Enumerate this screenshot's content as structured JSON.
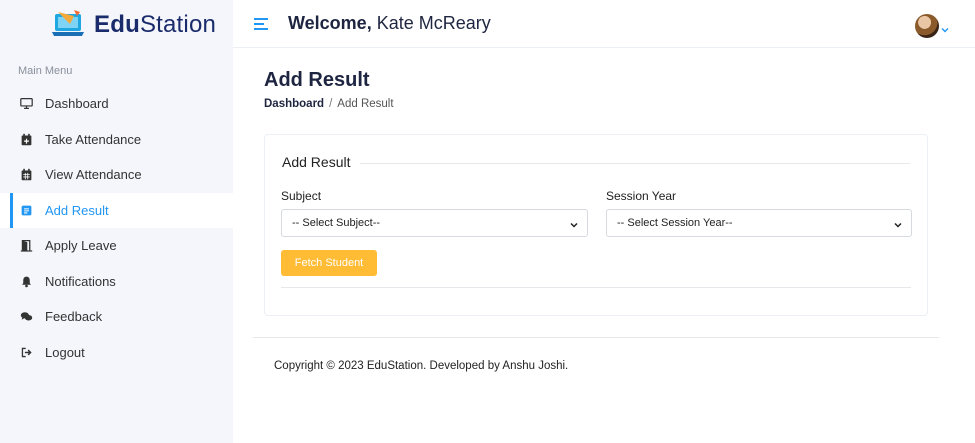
{
  "brand": {
    "name_bold": "Edu",
    "name_rest": "Station"
  },
  "header": {
    "welcome_prefix": "Welcome,",
    "user_name": "Kate McReary"
  },
  "sidebar": {
    "menu_title": "Main Menu",
    "items": [
      {
        "label": "Dashboard",
        "icon": "monitor-icon",
        "active": false
      },
      {
        "label": "Take Attendance",
        "icon": "calendar-plus-icon",
        "active": false
      },
      {
        "label": "View Attendance",
        "icon": "calendar-icon",
        "active": false
      },
      {
        "label": "Add Result",
        "icon": "document-icon",
        "active": true
      },
      {
        "label": "Apply Leave",
        "icon": "door-icon",
        "active": false
      },
      {
        "label": "Notifications",
        "icon": "bell-icon",
        "active": false
      },
      {
        "label": "Feedback",
        "icon": "comments-icon",
        "active": false
      },
      {
        "label": "Logout",
        "icon": "sign-out-icon",
        "active": false
      }
    ]
  },
  "page": {
    "title": "Add Result",
    "breadcrumb": {
      "home": "Dashboard",
      "separator": "/",
      "current": "Add Result"
    }
  },
  "form": {
    "card_title": "Add Result",
    "subject_label": "Subject",
    "subject_value": "-- Select Subject--",
    "session_label": "Session Year",
    "session_value": "-- Select Session Year--",
    "fetch_button": "Fetch Student"
  },
  "footer": {
    "text": "Copyright © 2023 EduStation. Developed by Anshu Joshi."
  },
  "colors": {
    "accent": "#2196f3",
    "button": "#ffbc34",
    "brand_dark": "#1a2b6b"
  }
}
